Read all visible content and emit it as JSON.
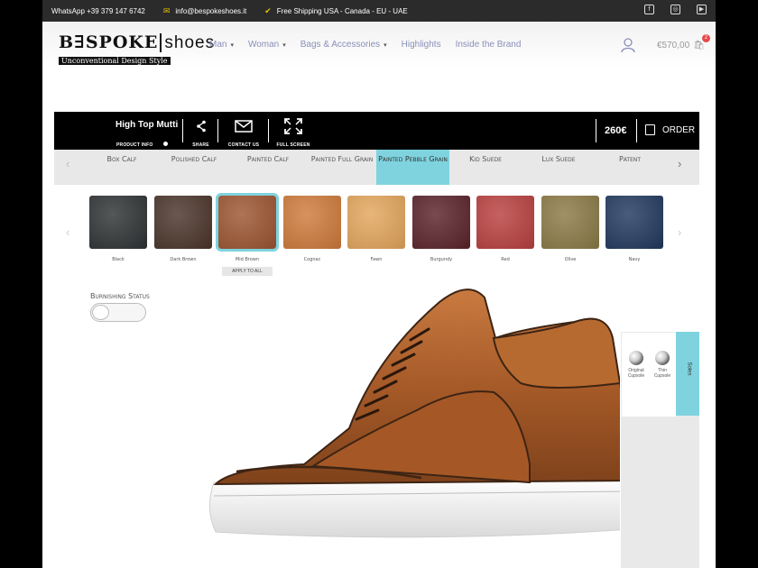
{
  "topbar": {
    "whatsapp": "WhatsApp +39 379 147 6742",
    "email": "info@bespokeshoes.it",
    "shipping": "Free Shipping USA - Canada - EU - UAE",
    "social_icons": [
      "facebook-icon",
      "instagram-icon",
      "youtube-icon"
    ]
  },
  "header": {
    "logo_main": "B∃SPOKE",
    "logo_suffix": "shoes",
    "logo_tagline": "Unconventional Design Style",
    "nav": [
      {
        "label": "Man",
        "dropdown": true
      },
      {
        "label": "Woman",
        "dropdown": true
      },
      {
        "label": "Bags & Accessories",
        "dropdown": true
      },
      {
        "label": "Highlights",
        "dropdown": false
      },
      {
        "label": "Inside the Brand",
        "dropdown": false
      }
    ],
    "cart_total": "€570,00",
    "cart_count": "2"
  },
  "configurator": {
    "model_name": "High Top Mutti",
    "product_info_label": "PRODUCT INFO",
    "share_label": "SHARE",
    "contact_label": "CONTACT US",
    "fullscreen_label": "FULL SCREEN",
    "price": "260€",
    "order_label": "ORDER"
  },
  "leather_tabs": {
    "items": [
      "Box Calf",
      "Polished Calf",
      "Painted Calf",
      "Painted Full Grain",
      "Painted Pebble Grain",
      "Kid Suede",
      "Lux Suede",
      "Patent"
    ],
    "active_index": 4
  },
  "swatches": {
    "items": [
      {
        "label": "Black",
        "color": "#2f3234"
      },
      {
        "label": "Dark Brown",
        "color": "#4a342a"
      },
      {
        "label": "Mid Brown",
        "color": "#9c5530"
      },
      {
        "label": "Cognac",
        "color": "#cf7a3a"
      },
      {
        "label": "Fawn",
        "color": "#e3a65c"
      },
      {
        "label": "Burgundy",
        "color": "#5a2329"
      },
      {
        "label": "Red",
        "color": "#b8403e"
      },
      {
        "label": "Olive",
        "color": "#8a7a45"
      },
      {
        "label": "Navy",
        "color": "#21385e"
      }
    ],
    "active_index": 2,
    "apply_all_label": "APPLY TO ALL"
  },
  "burnishing": {
    "label": "Burnishing Status",
    "on": false
  },
  "soles": {
    "tab_label": "Soles",
    "options": [
      {
        "label": "Original Cupsole"
      },
      {
        "label": "Thin Cupsole"
      }
    ]
  },
  "colors": {
    "accent": "#7fd3df",
    "topbar_bg": "#2b2b2b",
    "nav_text": "#8a8fb8",
    "shoe_leather": "#a85a2a"
  }
}
